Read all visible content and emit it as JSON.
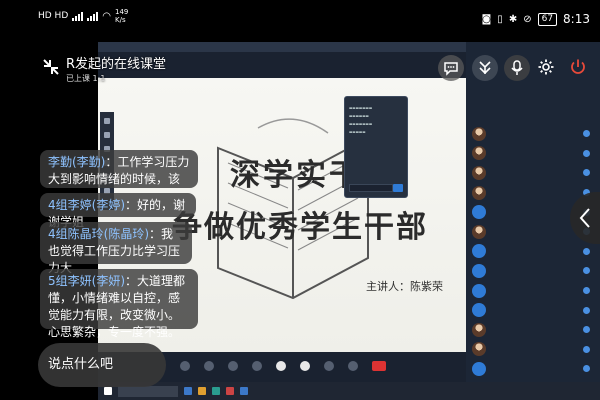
{
  "status_bar": {
    "left_indicators": "HD HD",
    "net_speed": "149\nK/s",
    "battery": "67",
    "time": "8:13"
  },
  "header": {
    "title": "R发起的在线课堂",
    "subtitle": "已上课 1:1",
    "icons": [
      "back-icon",
      "chat-icon",
      "brand-icon",
      "gear-icon",
      "power-icon"
    ]
  },
  "slide": {
    "line1": "深学实干",
    "line2": "争做优秀学生干部",
    "presenter": "主讲人：陈紫荣"
  },
  "chat": {
    "messages": [
      {
        "name": "李勤(李勤)",
        "text": "：工作学习压力大到影响情绪的时候，该怎么办释放呢"
      },
      {
        "name": "4组李婷(李婷)",
        "text": "：好的，谢谢学姐"
      },
      {
        "name": "4组陈晶玲(陈晶玲)",
        "text": "：我也觉得工作压力比学习压力大"
      },
      {
        "name": "5组李妍(李妍)",
        "text": "：大道理都懂，小情绪难以自控，感觉能力有限，改变微小。心思繁杂，专一度不强。"
      }
    ],
    "input_placeholder": "说点什么吧"
  },
  "colors": {
    "name_blue": "#8ec2ff",
    "accent_blue": "#2f7bd6",
    "power_red": "#e84a3a"
  }
}
